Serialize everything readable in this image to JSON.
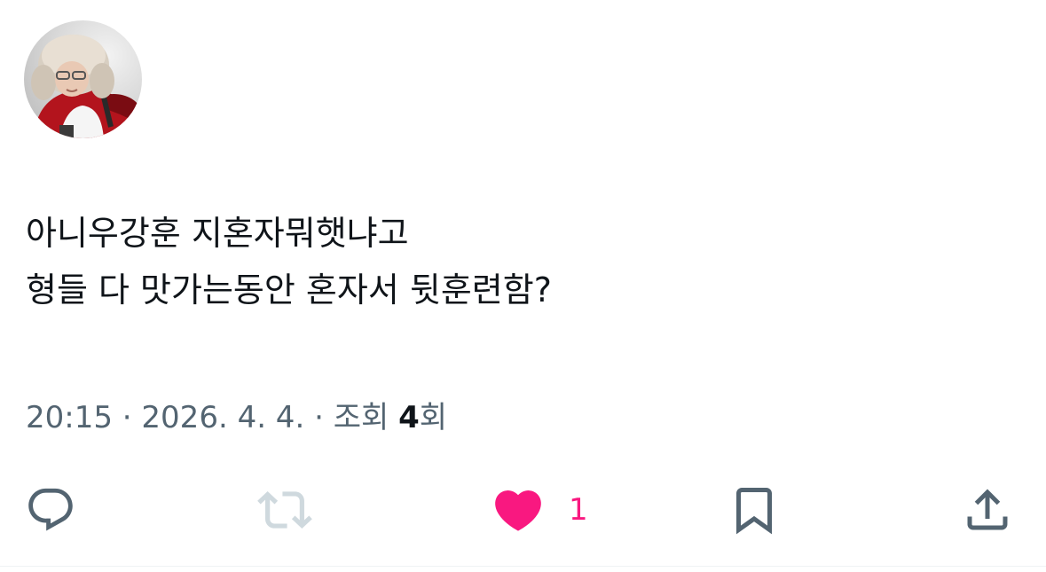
{
  "tweet": {
    "avatar_icon": "user-avatar-photo",
    "text_lines": [
      "아니우강훈 지혼자뭐햇냐고",
      "형들 다 맛가는동안 혼자서 뒷훈련함?"
    ],
    "time": "20:15",
    "date": "2026. 4. 4.",
    "separator": "·",
    "views_label": "조회",
    "views_count": "4",
    "views_suffix": "회"
  },
  "actions": {
    "reply_icon": "reply-icon",
    "retweet_icon": "retweet-icon",
    "like_icon": "heart-icon",
    "like_count": "1",
    "bookmark_icon": "bookmark-icon",
    "share_icon": "share-icon"
  },
  "colors": {
    "text": "#0f1419",
    "secondary": "#536471",
    "like": "#f91880",
    "icon": "#536471",
    "retweet_disabled": "#cfd9de"
  }
}
